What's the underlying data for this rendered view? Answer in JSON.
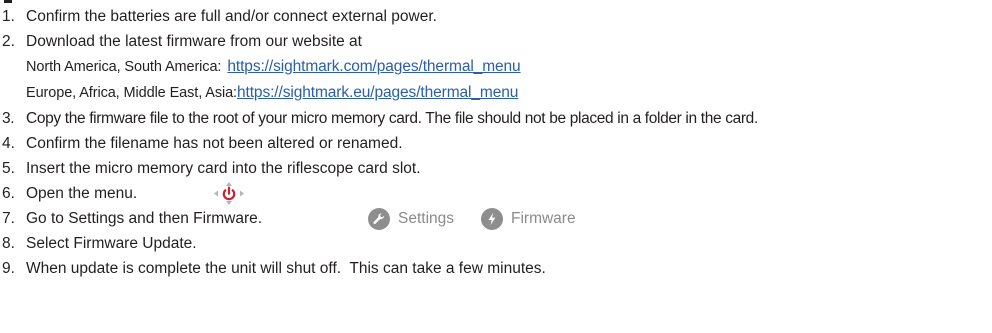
{
  "steps": [
    {
      "number": "1.",
      "text": "Confirm the batteries are full and/or connect external power."
    },
    {
      "number": "2.",
      "text": "Download the latest firmware from our website at",
      "regions": [
        {
          "label": "North America, South America:",
          "url": "https://sightmark.com/pages/thermal_menu"
        },
        {
          "label": "Europe, Africa, Middle East, Asia:",
          "url": "https://sightmark.eu/pages/thermal_menu"
        }
      ]
    },
    {
      "number": "3.",
      "text": "Copy the firmware file to the root of your micro memory card. The file should not be placed in a folder in the card."
    },
    {
      "number": "4.",
      "text": "Confirm the filename has not been altered or renamed."
    },
    {
      "number": "5.",
      "text": "Insert the micro memory card into the riflescope card slot."
    },
    {
      "number": "6.",
      "text": "Open the menu.",
      "icon": "power-control-pad-icon"
    },
    {
      "number": "7.",
      "text": "Go to Settings and then Firmware.",
      "chips": [
        {
          "label": "Settings",
          "icon": "wrench-icon"
        },
        {
          "label": "Firmware",
          "icon": "lightning-icon"
        }
      ]
    },
    {
      "number": "8.",
      "text": "Select Firmware Update."
    },
    {
      "number": "9.",
      "text": "When update is complete the unit will shut off.  This can take a few minutes."
    }
  ],
  "colors": {
    "text": "#231f20",
    "link": "#2a5ea8",
    "chip_text": "#8b8b8b",
    "chip_badge": "#8e8e8e",
    "power_red": "#d0202e"
  }
}
